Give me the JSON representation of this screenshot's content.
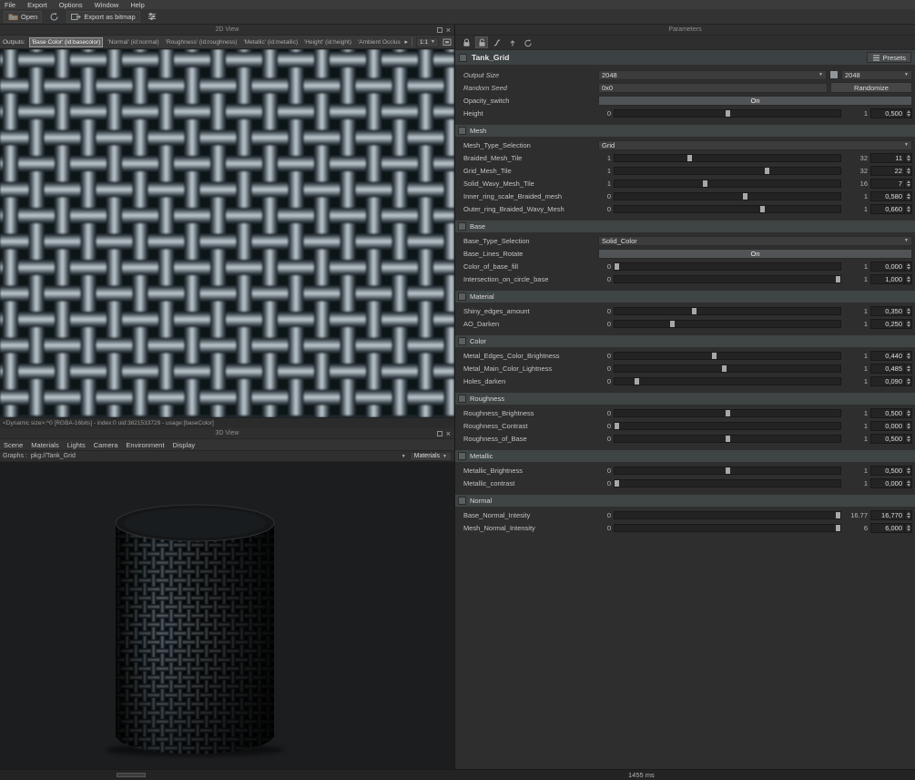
{
  "menubar": {
    "items": [
      "File",
      "Export",
      "Options",
      "Window",
      "Help"
    ]
  },
  "toolbar": {
    "open_label": "Open",
    "export_label": "Export as bitmap"
  },
  "view2d": {
    "title": "2D View",
    "outputs_label": "Outputs:",
    "outputs": [
      "'Base Color' (id:basecolor)",
      "'Normal' (id:normal)",
      "'Roughness' (id:roughness)",
      "'Metallic' (id:metallic)",
      "'Height' (id:height)",
      "'Ambient Occlusion' (id:ambien"
    ],
    "zoom_level": "1:1",
    "info": "<Dynamic size>:^0 [RGBA-16bits] - index:0 uid:3821533729 - usage:[baseColor]"
  },
  "view3d": {
    "title": "3D View",
    "menu_items": [
      "Scene",
      "Materials",
      "Lights",
      "Camera",
      "Environment",
      "Display"
    ],
    "graphs_label": "Graphs :",
    "graph_path": "pkg://Tank_Grid",
    "materials_label": "Materials"
  },
  "parameters": {
    "title": "Parameters",
    "graph_title": "Tank_Grid",
    "presets_label": "Presets",
    "sections": [
      {
        "name": "",
        "rows": [
          {
            "type": "size",
            "label": "Output Size",
            "value": "2048",
            "value2": "2048"
          },
          {
            "type": "seed",
            "label": "Random Seed",
            "value": "0x0",
            "button": "Randomize"
          },
          {
            "type": "toggle",
            "label": "Opacity_switch",
            "value": "On"
          },
          {
            "type": "slider",
            "label": "Height",
            "min": "0",
            "max": "1",
            "value": "0,500",
            "frac": 0.5
          }
        ]
      },
      {
        "name": "Mesh",
        "rows": [
          {
            "type": "dropdown",
            "label": "Mesh_Type_Selection",
            "value": "Grid"
          },
          {
            "type": "slider",
            "label": "Braided_Mesh_Tile",
            "min": "1",
            "max": "32",
            "value": "11",
            "frac": 0.33
          },
          {
            "type": "slider",
            "label": "Grid_Mesh_Tile",
            "min": "1",
            "max": "32",
            "value": "22",
            "frac": 0.68
          },
          {
            "type": "slider",
            "label": "Solid_Wavy_Mesh_Tile",
            "min": "1",
            "max": "16",
            "value": "7",
            "frac": 0.4
          },
          {
            "type": "slider",
            "label": "Inner_ring_scale_Braided_mesh",
            "min": "0",
            "max": "1",
            "value": "0,580",
            "frac": 0.58
          },
          {
            "type": "slider",
            "label": "Outer_ring_Braided_Wavy_Mesh",
            "min": "0",
            "max": "1",
            "value": "0,660",
            "frac": 0.66
          }
        ]
      },
      {
        "name": "Base",
        "rows": [
          {
            "type": "dropdown",
            "label": "Base_Type_Selection",
            "value": "Solid_Color"
          },
          {
            "type": "toggle",
            "label": "Base_Lines_Rotate",
            "value": "On"
          },
          {
            "type": "slider",
            "label": "Color_of_base_fill",
            "min": "0",
            "max": "1",
            "value": "0,000",
            "frac": 0
          },
          {
            "type": "slider",
            "label": "Intersection_on_circle_base",
            "min": "0",
            "max": "1",
            "value": "1,000",
            "frac": 1
          }
        ]
      },
      {
        "name": "Material",
        "rows": [
          {
            "type": "slider",
            "label": "Shiny_edges_amount",
            "min": "0",
            "max": "1",
            "value": "0,350",
            "frac": 0.35
          },
          {
            "type": "slider",
            "label": "AO_Darken",
            "min": "0",
            "max": "1",
            "value": "0,250",
            "frac": 0.25
          }
        ]
      },
      {
        "name": "Color",
        "rows": [
          {
            "type": "slider",
            "label": "Metal_Edges_Color_Brightness",
            "min": "0",
            "max": "1",
            "value": "0,440",
            "frac": 0.44
          },
          {
            "type": "slider",
            "label": "Metal_Main_Color_Lightness",
            "min": "0",
            "max": "1",
            "value": "0,485",
            "frac": 0.485
          },
          {
            "type": "slider",
            "label": "Holes_darken",
            "min": "0",
            "max": "1",
            "value": "0,090",
            "frac": 0.09
          }
        ]
      },
      {
        "name": "Roughness",
        "rows": [
          {
            "type": "slider",
            "label": "Roughness_Brightness",
            "min": "0",
            "max": "1",
            "value": "0,500",
            "frac": 0.5
          },
          {
            "type": "slider",
            "label": "Roughness_Contrast",
            "min": "0",
            "max": "1",
            "value": "0,000",
            "frac": 0
          },
          {
            "type": "slider",
            "label": "Roughness_of_Base",
            "min": "0",
            "max": "1",
            "value": "0,500",
            "frac": 0.5
          }
        ]
      },
      {
        "name": "Metallic",
        "rows": [
          {
            "type": "slider",
            "label": "Metallic_Brightness",
            "min": "0",
            "max": "1",
            "value": "0,500",
            "frac": 0.5
          },
          {
            "type": "slider",
            "label": "Metallic_contrast",
            "min": "0",
            "max": "1",
            "value": "0,000",
            "frac": 0
          }
        ]
      },
      {
        "name": "Normal",
        "rows": [
          {
            "type": "slider",
            "label": "Base_Normal_Intesity",
            "min": "0",
            "max": "16.77",
            "value": "16,770",
            "frac": 1
          },
          {
            "type": "slider",
            "label": "Mesh_Normal_Intensity",
            "min": "0",
            "max": "6",
            "value": "6,000",
            "frac": 1
          }
        ]
      }
    ]
  },
  "status": {
    "time": "1455 ms"
  }
}
